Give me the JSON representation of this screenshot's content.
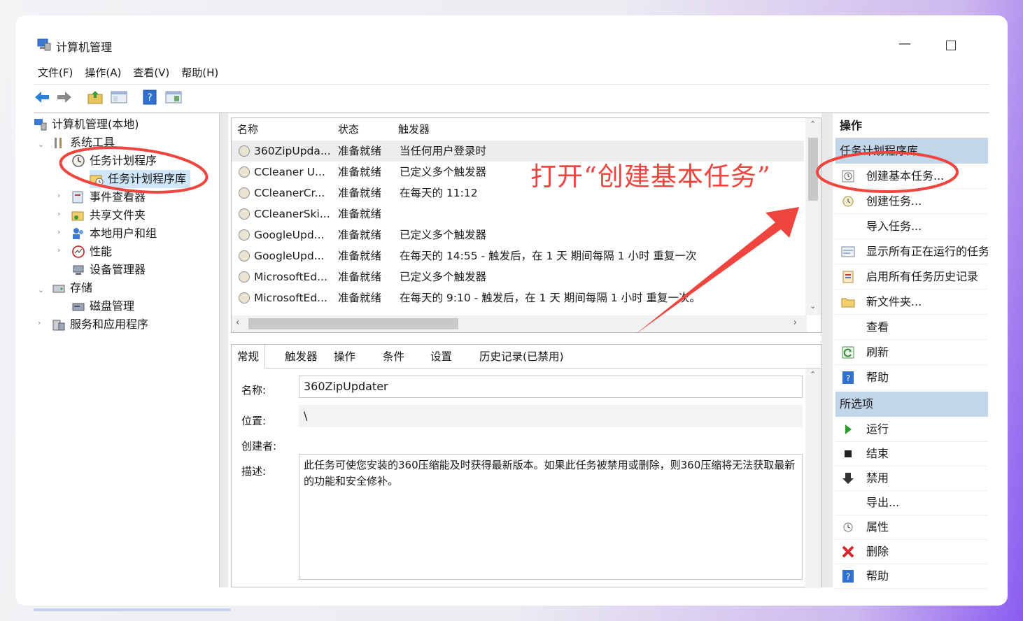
{
  "window": {
    "title": "计算机管理",
    "minimize_glyph": "—",
    "menu": [
      "文件(F)",
      "操作(A)",
      "查看(V)",
      "帮助(H)"
    ]
  },
  "toolbar": {
    "icons": [
      "back-arrow-icon",
      "forward-arrow-icon",
      "up-folder-icon",
      "show-hide-tree-icon",
      "help-icon",
      "console-pane-icon"
    ]
  },
  "tree": {
    "root": "计算机管理(本地)",
    "system_tools": "系统工具",
    "task_scheduler": "任务计划程序",
    "task_scheduler_library": "任务计划程序库",
    "event_viewer": "事件查看器",
    "shared_folders": "共享文件夹",
    "local_users": "本地用户和组",
    "performance": "性能",
    "device_manager": "设备管理器",
    "storage": "存储",
    "disk_management": "磁盘管理",
    "services_apps": "服务和应用程序"
  },
  "tasklist": {
    "headers": {
      "name": "名称",
      "status": "状态",
      "trigger": "触发器"
    },
    "rows": [
      {
        "name": "360ZipUpda...",
        "status": "准备就绪",
        "trigger": "当任何用户登录时"
      },
      {
        "name": "CCleaner U...",
        "status": "准备就绪",
        "trigger": "已定义多个触发器"
      },
      {
        "name": "CCleanerCr...",
        "status": "准备就绪",
        "trigger": "在每天的 11:12"
      },
      {
        "name": "CCleanerSki...",
        "status": "准备就绪",
        "trigger": ""
      },
      {
        "name": "GoogleUpd...",
        "status": "准备就绪",
        "trigger": "已定义多个触发器"
      },
      {
        "name": "GoogleUpd...",
        "status": "准备就绪",
        "trigger": "在每天的 14:55 - 触发后，在 1 天 期间每隔 1 小时 重复一次"
      },
      {
        "name": "MicrosoftEd...",
        "status": "准备就绪",
        "trigger": "已定义多个触发器"
      },
      {
        "name": "MicrosoftEd...",
        "status": "准备就绪",
        "trigger": "在每天的 9:10 - 触发后，在 1 天 期间每隔 1 小时 重复一次。"
      }
    ]
  },
  "detail": {
    "tabs": [
      "常规",
      "触发器",
      "操作",
      "条件",
      "设置",
      "历史记录(已禁用)"
    ],
    "name_label": "名称:",
    "name_value": "360ZipUpdater",
    "location_label": "位置:",
    "location_value": "\\",
    "author_label": "创建者:",
    "desc_label": "描述:",
    "desc_value": "此任务可使您安装的360压缩能及时获得最新版本。如果此任务被禁用或删除，则360压缩将无法获取最新的功能和安全修补。"
  },
  "actions": {
    "header": "操作",
    "section1": "任务计划程序库",
    "items1": [
      {
        "label": "创建基本任务...",
        "icon": "create-basic-task-icon"
      },
      {
        "label": "创建任务...",
        "icon": "create-task-icon"
      },
      {
        "label": "导入任务...",
        "icon": ""
      },
      {
        "label": "显示所有正在运行的任务",
        "icon": "running-tasks-icon"
      },
      {
        "label": "启用所有任务历史记录",
        "icon": "history-icon"
      },
      {
        "label": "新文件夹...",
        "icon": "folder-icon"
      },
      {
        "label": "查看",
        "icon": ""
      },
      {
        "label": "刷新",
        "icon": "refresh-icon"
      },
      {
        "label": "帮助",
        "icon": "help-icon"
      }
    ],
    "section2": "所选项",
    "items2": [
      {
        "label": "运行",
        "icon": "run-icon"
      },
      {
        "label": "结束",
        "icon": "stop-icon"
      },
      {
        "label": "禁用",
        "icon": "disable-icon"
      },
      {
        "label": "导出...",
        "icon": ""
      },
      {
        "label": "属性",
        "icon": "properties-icon"
      },
      {
        "label": "删除",
        "icon": "delete-icon"
      },
      {
        "label": "帮助",
        "icon": "help-icon"
      }
    ]
  },
  "annotation": {
    "callout": "打开“创建基本任务”",
    "color": "#f0443e"
  }
}
